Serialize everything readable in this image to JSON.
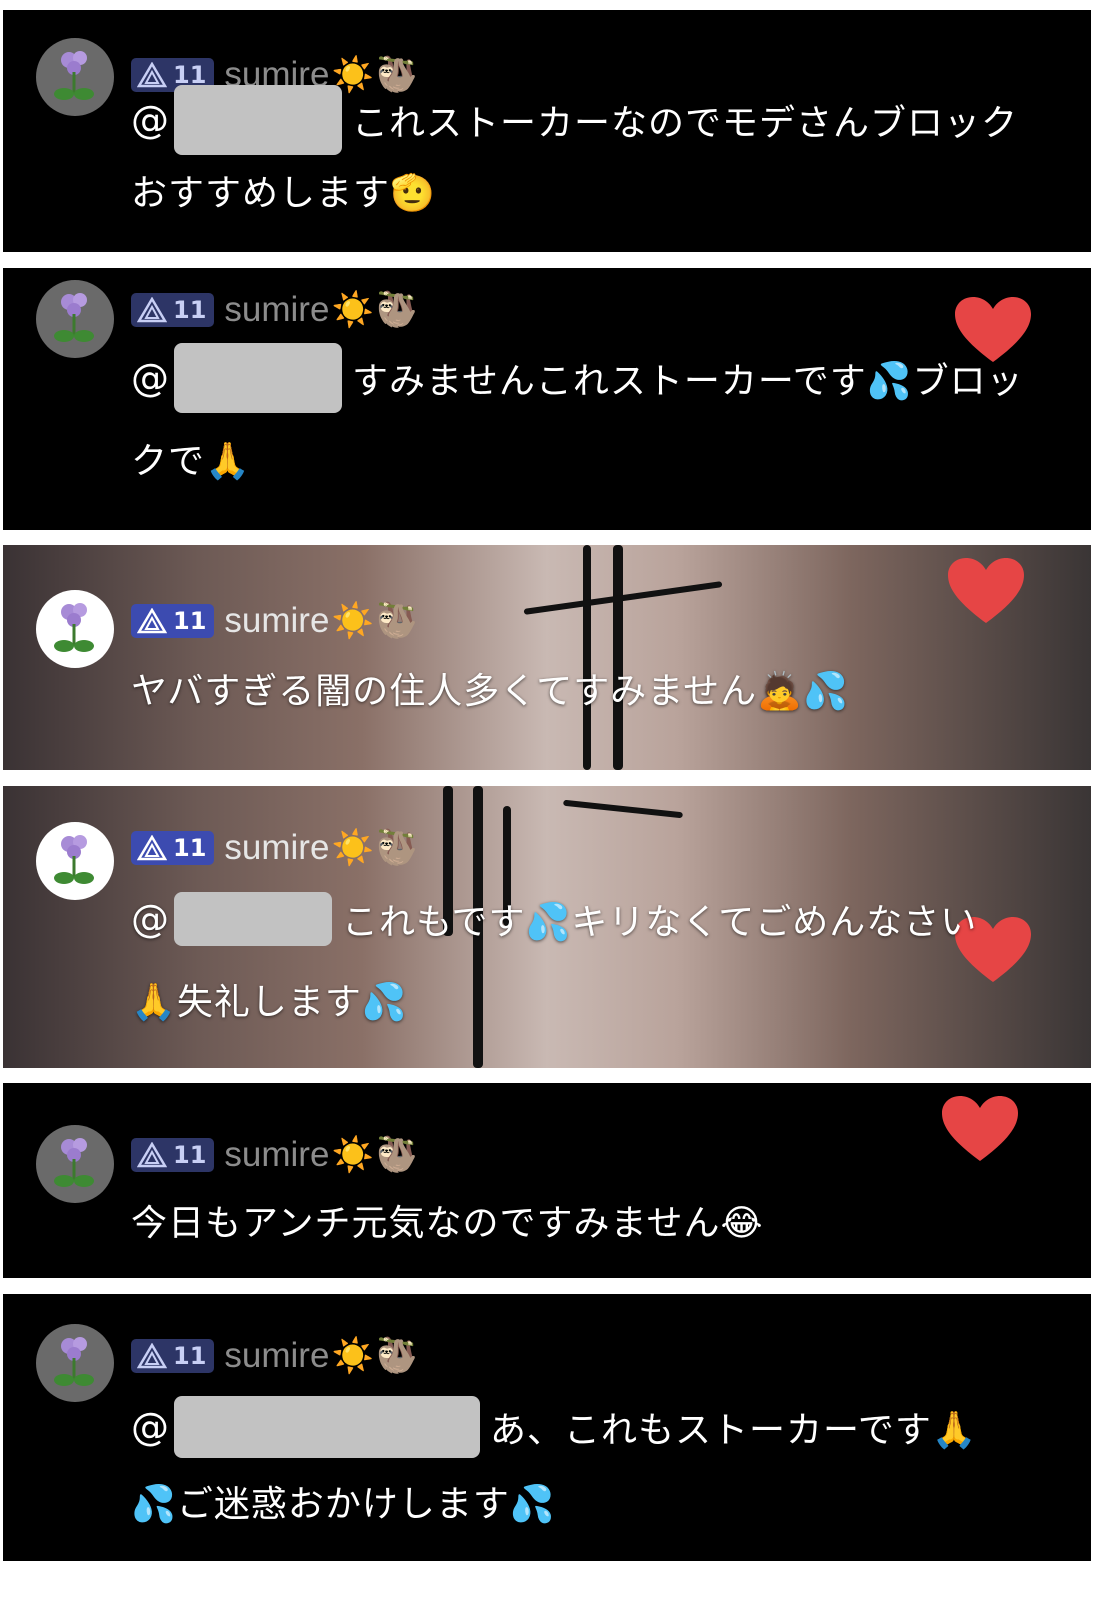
{
  "username": "sumire",
  "level": "11",
  "colors": {
    "badge_bg": "#2d3566",
    "heart": "#e64545",
    "mask": "#c2c2c2",
    "text": "#ffffff"
  },
  "header_emojis": [
    "sun-emoji",
    "sloth-emoji"
  ],
  "comments": [
    {
      "mention": "@",
      "lines": [
        "これストーカーなのでモデさんブロック",
        "おすすめします🫡"
      ]
    },
    {
      "mention": "@",
      "lines": [
        "すみませんこれストーカーです💦ブロッ",
        "クで🙏"
      ]
    },
    {
      "lines": [
        "ヤバすぎる闇の住人多くてすみません🙇💦"
      ]
    },
    {
      "mention": "@",
      "lines": [
        "これもです💦キリなくてごめんなさい",
        "🙏失礼します💦"
      ]
    },
    {
      "lines": [
        "今日もアンチ元気なのですみません😂"
      ]
    },
    {
      "mention": "@",
      "lines": [
        "あ、これもストーカーです🙏",
        "💦ご迷惑おかけします💦"
      ]
    }
  ]
}
